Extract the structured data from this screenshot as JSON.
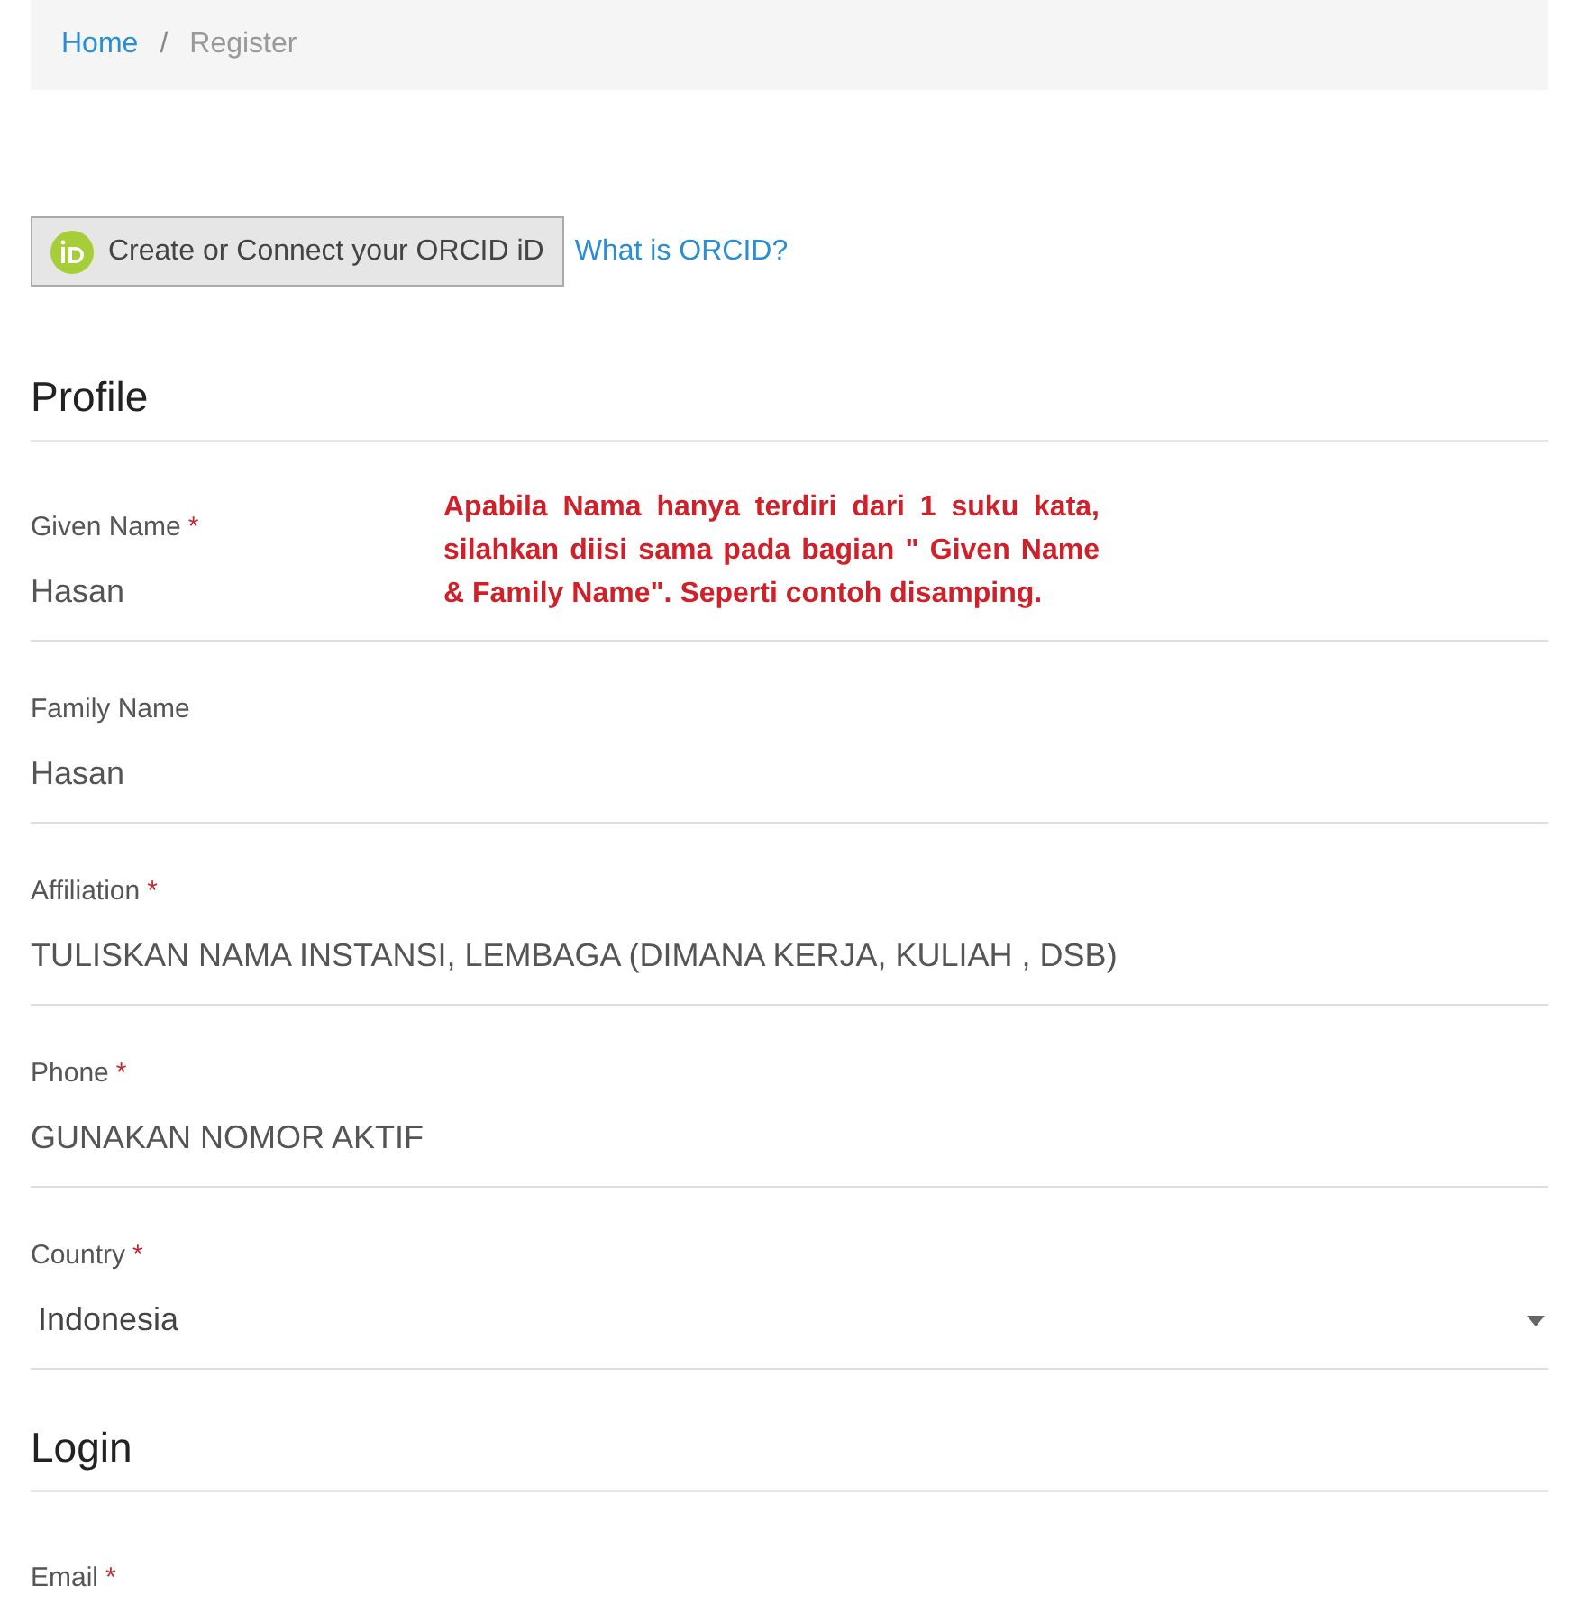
{
  "breadcrumb": [
    {
      "label": "Home",
      "kind": "link"
    },
    {
      "label": "/",
      "kind": "separator"
    },
    {
      "label": "Register",
      "kind": "current"
    }
  ],
  "orcid": {
    "button": "Create or Connect your ORCID iD",
    "link": "What is ORCID?"
  },
  "sections": [
    {
      "heading": "Profile",
      "fields": [
        {
          "label": "Given Name",
          "required_mark": "*",
          "kind": "text",
          "value": "Hasan"
        },
        {
          "label": "Family Name",
          "kind": "text",
          "value": "Hasan"
        },
        {
          "label": "Affiliation",
          "required_mark": "*",
          "kind": "text",
          "value": "TULISKAN NAMA INSTANSI, LEMBAGA (DIMANA KERJA, KULIAH , DSB)"
        },
        {
          "label": "Phone",
          "required_mark": "*",
          "kind": "text",
          "value": "GUNAKAN NOMOR AKTIF"
        },
        {
          "label": "Country",
          "required_mark": "*",
          "kind": "select",
          "value": "Indonesia"
        }
      ]
    },
    {
      "heading": "Login",
      "fields": [
        {
          "label": "Email",
          "required_mark": "*",
          "kind": "text"
        }
      ]
    }
  ],
  "annotation": "Apabila Nama hanya terdiri dari 1 suku kata, silahkan diisi sama pada bagian \" Given Name & Family Name\". Seperti contoh disamping."
}
